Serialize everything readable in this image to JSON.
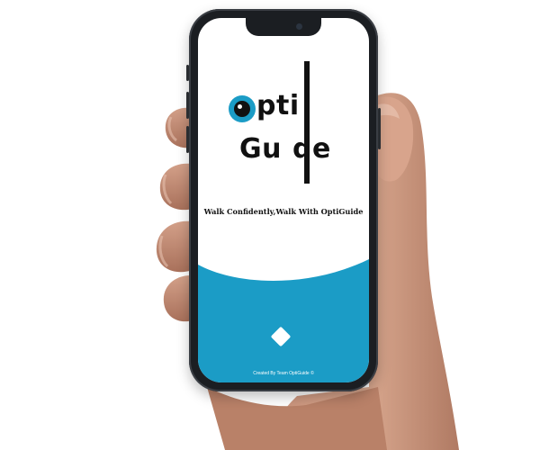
{
  "app": {
    "logo_line1": "pti",
    "logo_line2": "Gu",
    "logo_line2_end": "de",
    "tagline": "Walk Confidently,Walk With OptiGuide",
    "credit": "Created By Team OptiGuide ©"
  },
  "colors": {
    "accent": "#1b9cc6",
    "phone_frame": "#1b1e22",
    "logo_text": "#111111"
  },
  "icons": {
    "eye": "eye-logo-icon",
    "action": "diamond-icon"
  }
}
